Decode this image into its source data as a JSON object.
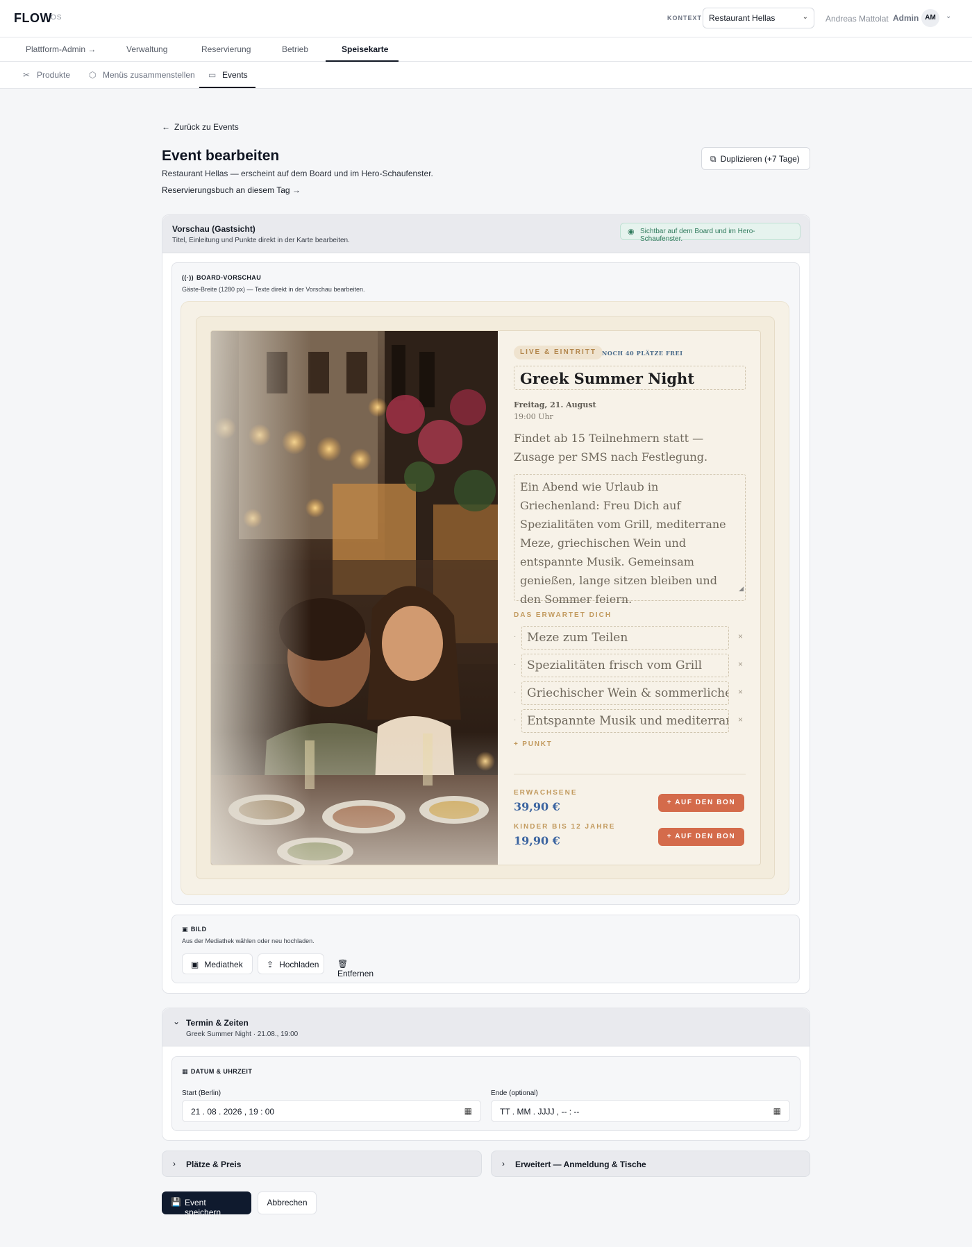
{
  "app": {
    "logo": "FLOW",
    "logo_suffix": "OS"
  },
  "context": {
    "label": "KONTEXT",
    "selected": "Restaurant Hellas"
  },
  "user": {
    "name": "Andreas Mattolat",
    "role": "Admin",
    "initials": "AM"
  },
  "main_tabs": [
    {
      "label": "Plattform-Admin →"
    },
    {
      "label": "Verwaltung"
    },
    {
      "label": "Reservierung"
    },
    {
      "label": "Betrieb"
    },
    {
      "label": "Speisekarte",
      "active": true
    }
  ],
  "sub_tabs": [
    {
      "label": "Produkte"
    },
    {
      "label": "Menüs zusammenstellen"
    },
    {
      "label": "Events",
      "active": true
    }
  ],
  "page": {
    "back": "Zurück zu Events",
    "title": "Event bearbeiten",
    "subtitle": "Restaurant Hellas — erscheint auf dem Board und im Hero-Schaufenster.",
    "res_link": "Reservierungsbuch an diesem Tag →",
    "duplicate": "Duplizieren (+7 Tage)"
  },
  "preview": {
    "title": "Vorschau (Gastsicht)",
    "subtitle": "Titel, Einleitung und Punkte direkt in der Karte bearbeiten.",
    "visibility": "Sichtbar auf dem Board und im Hero-Schaufenster.",
    "board_head": "BOARD-VORSCHAU",
    "board_sub": "Gäste-Breite (1280 px) — Texte direkt in der Vorschau bearbeiten."
  },
  "event": {
    "tag": "LIVE & EINTRITT",
    "free": "NOCH 40 PLÄTZE FREI",
    "title": "Greek Summer Night",
    "date": "Freitag, 21. August",
    "time": "19:00 Uhr",
    "note": "Findet ab 15 Teilnehmern statt — Zusage per SMS nach Festlegung.",
    "description": "Ein Abend wie Urlaub in Griechenland: Freu Dich auf Spezialitäten vom Grill, mediterrane Meze, griechischen Wein und entspannte Musik. Gemeinsam genießen, lange sitzen bleiben und den Sommer feiern.",
    "expect_head": "DAS ERWARTET DICH",
    "items": [
      "Meze zum Teilen",
      "Spezialitäten frisch vom Grill",
      "Griechischer Wein & sommerliche D",
      "Entspannte Musik und mediterrane ."
    ],
    "add_point": "+ PUNKT",
    "prices": [
      {
        "label": "ERWACHSENE",
        "value": "39,90 €",
        "button": "+  AUF DEN BON"
      },
      {
        "label": "KINDER BIS 12 JAHRE",
        "value": "19,90 €",
        "button": "+  AUF DEN BON"
      }
    ]
  },
  "image": {
    "head": "BILD",
    "sub": "Aus der Mediathek wählen oder neu hochladen.",
    "buttons": [
      "Mediathek",
      "Hochladen",
      "Entfernen"
    ]
  },
  "schedule": {
    "title": "Termin & Zeiten",
    "subtitle": "Greek Summer Night · 21.08., 19:00",
    "head": "DATUM & UHRZEIT",
    "start_label": "Start (Berlin)",
    "start_value": "21 . 08 . 2026 ,  19 : 00",
    "end_label": "Ende (optional)",
    "end_value": "TT . MM . JJJJ ,  -- : --"
  },
  "collapsed": [
    "Plätze & Preis",
    "Erweitert — Anmeldung & Tische"
  ],
  "actions": {
    "save": "Event speichern",
    "cancel": "Abbrechen"
  },
  "icons": {
    "back": "arrow-left-icon",
    "duplicate": "copy-icon",
    "eye": "eye-icon",
    "broadcast": "broadcast-icon",
    "image": "image-icon",
    "upload": "upload-icon",
    "trash": "trash-icon",
    "calendar": "calendar-icon",
    "save": "save-icon"
  },
  "colors": {
    "primary": "#0f1a2e",
    "accent_orange": "#d46b4b",
    "price_blue": "#3b64a0",
    "gold": "#c29a5e",
    "visible_green": "#2f7a5c"
  }
}
